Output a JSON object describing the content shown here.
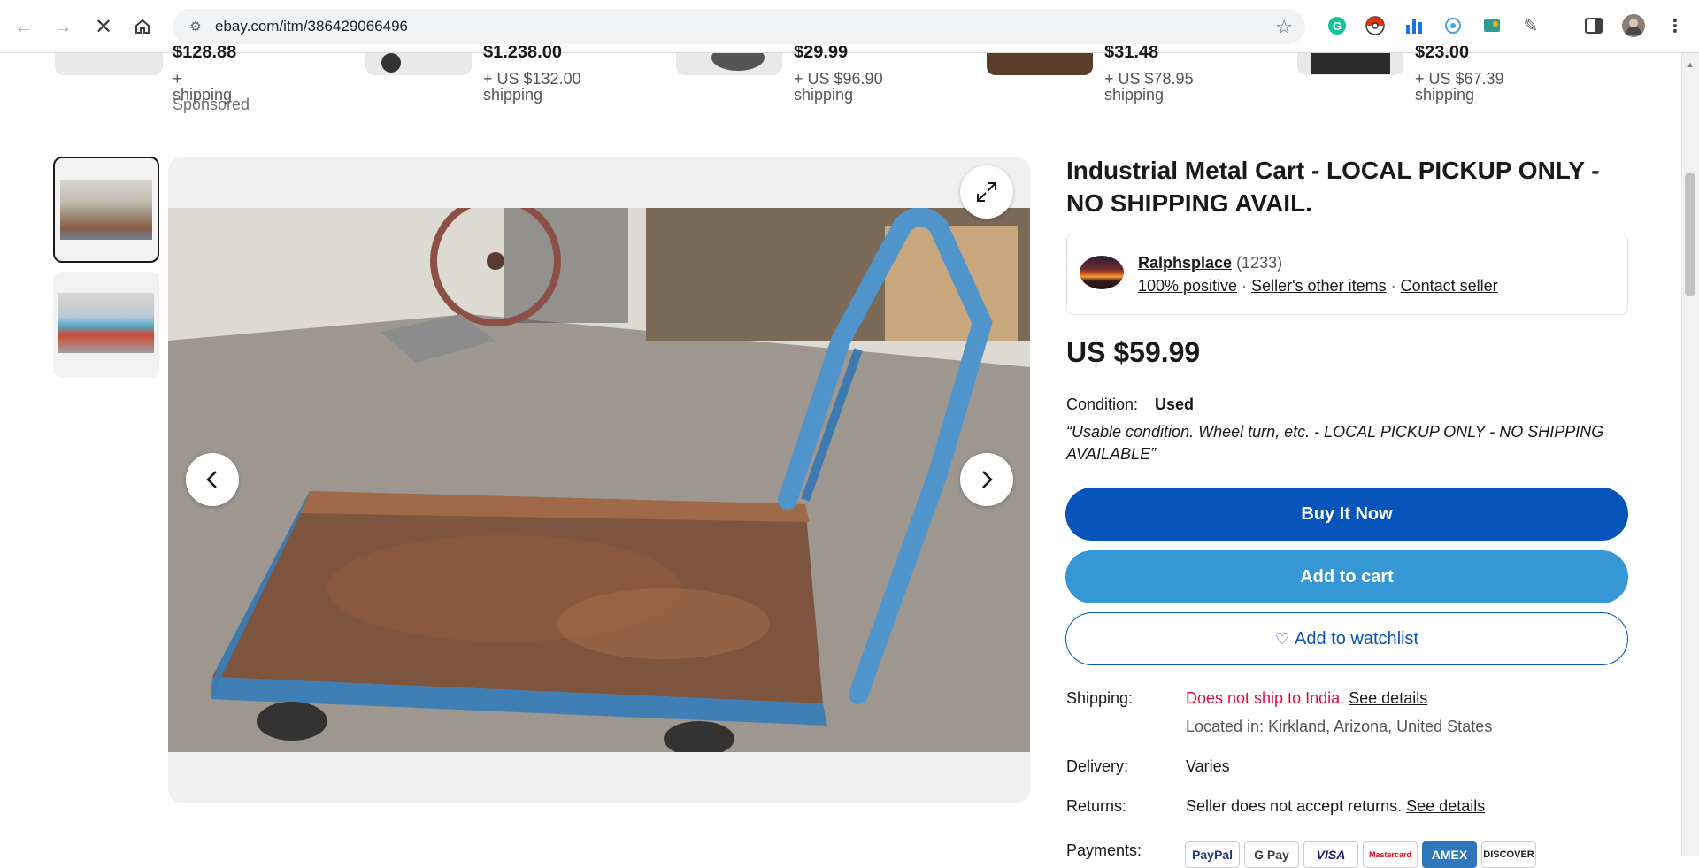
{
  "browser": {
    "url": "ebay.com/itm/386429066496",
    "back_icon": "arrow-left-icon",
    "forward_icon": "arrow-right-icon",
    "stop_icon": "close-icon",
    "home_icon": "home-icon"
  },
  "carousel": [
    {
      "price": "$128.88",
      "shipping": "+ shipping",
      "sponsored": "Sponsored"
    },
    {
      "price": "$1,238.00",
      "shipping": "+ US $132.00 shipping"
    },
    {
      "price": "$29.99",
      "shipping": "+ US $96.90 shipping"
    },
    {
      "price": "$31.48",
      "shipping": "+ US $78.95 shipping"
    },
    {
      "price": "$23.00",
      "shipping": "+ US $67.39 shipping"
    }
  ],
  "product": {
    "title": "Industrial Metal Cart - LOCAL PICKUP ONLY - NO SHIPPING AVAIL.",
    "price": "US $59.99",
    "condition_label": "Condition:",
    "condition_value": "Used",
    "condition_note": "“Usable condition. Wheel turn, etc. - LOCAL PICKUP ONLY - NO SHIPPING AVAILABLE”"
  },
  "seller": {
    "name": "Ralphsplace",
    "feedback_count": "(1233)",
    "positive": "100% positive",
    "other_items": "Seller's other items",
    "contact": "Contact seller",
    "separator": "·"
  },
  "actions": {
    "buy_now": "Buy It Now",
    "add_to_cart": "Add to cart",
    "watchlist": "Add to watchlist"
  },
  "details": {
    "shipping_label": "Shipping:",
    "shipping_value": "Does not ship to India.",
    "shipping_link": "See details",
    "location": "Located in: Kirkland, Arizona, United States",
    "delivery_label": "Delivery:",
    "delivery_value": "Varies",
    "returns_label": "Returns:",
    "returns_value": "Seller does not accept returns.",
    "returns_link": "See details",
    "payments_label": "Payments:"
  },
  "payments": [
    "PayPal",
    "G Pay",
    "VISA",
    "Mastercard",
    "AMEX",
    "DISCOVER"
  ]
}
